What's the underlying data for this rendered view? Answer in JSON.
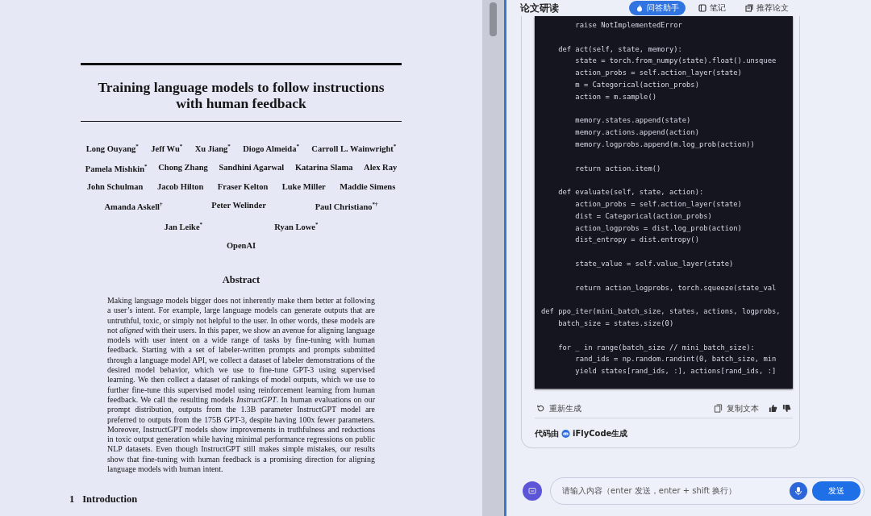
{
  "paper": {
    "title": "Training language models to follow instructions with human feedback",
    "author_rows": [
      [
        "Long Ouyang$^{*}$",
        "Jeff Wu$^{*}$",
        "Xu Jiang$^{*}$",
        "Diogo Almeida$^{*}$",
        "Carroll L. Wainwright$^{*}$"
      ],
      [
        "Pamela Mishkin$^{*}$",
        "Chong Zhang",
        "Sandhini Agarwal",
        "Katarina Slama",
        "Alex Ray"
      ],
      [
        "John Schulman",
        "Jacob Hilton",
        "Fraser Kelton",
        "Luke Miller",
        "Maddie Simens"
      ],
      [
        "Amanda Askell$^{†}$",
        "Peter Welinder",
        "Paul Christiano$^{*†}$"
      ],
      [
        "Jan Leike$^{*}$",
        "Ryan Lowe$^{*}$"
      ]
    ],
    "affiliation": "OpenAI",
    "abstract_heading": "Abstract",
    "abstract": "Making language models bigger does not inherently make them better at following a user’s intent. For example, large language models can generate outputs that are untruthful, toxic, or simply not helpful to the user. In other words, these models are not *aligned* with their users. In this paper, we show an avenue for aligning language models with user intent on a wide range of tasks by fine-tuning with human feedback. Starting with a set of labeler-written prompts and prompts submitted through a language model API, we collect a dataset of labeler demonstrations of the desired model behavior, which we use to fine-tune GPT-3 using supervised learning. We then collect a dataset of rankings of model outputs, which we use to further fine-tune this supervised model using reinforcement learning from human feedback. We call the resulting models *InstructGPT*. In human evaluations on our prompt distribution, outputs from the 1.3B parameter InstructGPT model are preferred to outputs from the 175B GPT-3, despite having 100x fewer parameters. Moreover, InstructGPT models show improvements in truthfulness and reductions in toxic output generation while having minimal performance regressions on public NLP datasets. Even though InstructGPT still makes simple mistakes, our results show that fine-tuning with human feedback is a promising direction for aligning language models with human intent.",
    "section": {
      "number": "1",
      "title": "Introduction"
    }
  },
  "panel": {
    "title": "论文研读",
    "tabs": [
      {
        "label": "问答助手",
        "selected": true
      },
      {
        "label": "笔记",
        "selected": false
      },
      {
        "label": "推荐论文",
        "selected": false
      }
    ]
  },
  "answer": {
    "code_blocks": [
      [
        "        raise NotImplementedError"
      ],
      [
        "    def act(self, state, memory):",
        "        state = torch.from_numpy(state).float().unsquee",
        "        action_probs = self.action_layer(state)",
        "        m = Categorical(action_probs)",
        "        action = m.sample()"
      ],
      [
        "        memory.states.append(state)",
        "        memory.actions.append(action)",
        "        memory.logprobs.append(m.log_prob(action))"
      ],
      [
        "        return action.item()"
      ],
      [
        "    def evaluate(self, state, action):",
        "        action_probs = self.action_layer(state)",
        "        dist = Categorical(action_probs)",
        "        action_logprobs = dist.log_prob(action)",
        "        dist_entropy = dist.entropy()"
      ],
      [
        "        state_value = self.value_layer(state)"
      ],
      [
        "        return action_logprobs, torch.squeeze(state_val"
      ],
      [
        "def ppo_iter(mini_batch_size, states, actions, logprobs,",
        "    batch_size = states.size(0)"
      ],
      [
        "    for _ in range(batch_size // mini_batch_size):",
        "        rand_ids = np.random.randint(0, batch_size, min",
        "        yield states[rand_ids, :], actions[rand_ids, :]"
      ]
    ],
    "regenerate": "重新生成",
    "copy": "复制文本",
    "credit_prefix": "代码由",
    "credit_brand": "iFlyCode生成"
  },
  "composer": {
    "placeholder": "请输入内容（enter 发送，enter + shift 换行）",
    "send": "发送"
  }
}
